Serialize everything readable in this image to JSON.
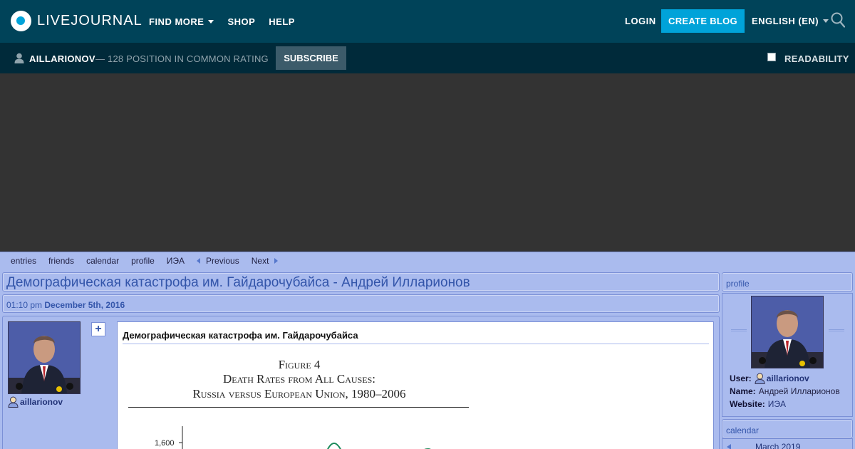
{
  "header": {
    "logo_text": "LIVEJOURNAL",
    "nav": [
      {
        "label": "FIND MORE",
        "has_caret": true
      },
      {
        "label": "SHOP",
        "has_caret": false
      },
      {
        "label": "HELP",
        "has_caret": false
      }
    ],
    "login_label": "LOGIN",
    "create_blog_label": "CREATE BLOG",
    "language_label": "ENGLISH (EN)",
    "search_icon": "search-icon"
  },
  "subbar": {
    "username": "AILLARIONOV",
    "rating_text": "— 128 POSITION IN COMMON RATING",
    "subscribe_label": "SUBSCRIBE",
    "readability_label": "READABILITY"
  },
  "journal_nav": {
    "items": [
      "entries",
      "friends",
      "calendar",
      "profile",
      "ИЭА"
    ],
    "previous_label": "Previous",
    "next_label": "Next"
  },
  "entry": {
    "page_title": "Демографическая катастрофа им. Гайдарочубайса - Андрей Илларионов",
    "time": "01:10 pm",
    "date": "December 5th, 2016",
    "author": "aillarionov",
    "add_symbol": "+",
    "subject": "Демографическая катастрофа им. Гайдарочубайса",
    "figure": {
      "caption_line1": "Figure 4",
      "caption_line2": "Death Rates from All Causes:",
      "caption_line3": "Russia versus European Union, 1980–2006",
      "tick_label": "1,600"
    }
  },
  "sidebar": {
    "profile_heading": "profile",
    "user_label": "User:",
    "user_value": "aillarionov",
    "name_label": "Name:",
    "name_value": "Андрей Илларионов",
    "website_label": "Website:",
    "website_value": "ИЭА",
    "calendar_heading": "calendar",
    "calendar_month": "March 2019"
  },
  "colors": {
    "topbar": "#004359",
    "subbar": "#002a3a",
    "accent": "#00a3d9",
    "journal_bg": "#aabbee",
    "link": "#3355aa"
  }
}
